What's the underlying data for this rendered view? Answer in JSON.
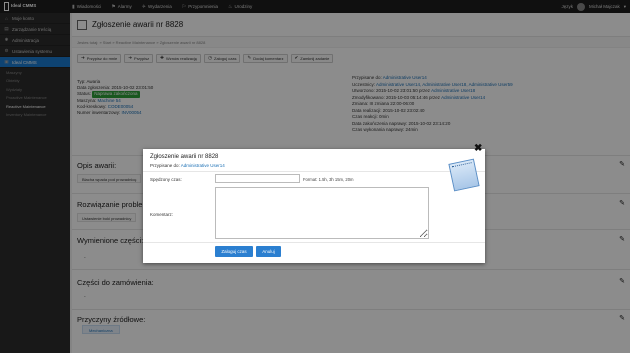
{
  "topbar": {
    "logo": "Ideal CMMS",
    "nav": [
      {
        "icon": "bell-icon",
        "label": "Wiadomości"
      },
      {
        "icon": "alarm-icon",
        "label": "Alarmy"
      },
      {
        "icon": "plane-icon",
        "label": "Wydarzenia"
      },
      {
        "icon": "flag-icon",
        "label": "Przypomnienia"
      },
      {
        "icon": "fire-icon",
        "label": "Urodziny"
      }
    ],
    "language": "Język",
    "user": "Michał Majczak"
  },
  "sidebar": {
    "items": [
      {
        "icon": "home-icon",
        "label": "Moje konto"
      },
      {
        "icon": "chart-icon",
        "label": "Zarządzanie treścią"
      },
      {
        "icon": "gear-icon",
        "label": "Administracja"
      },
      {
        "icon": "tools-icon",
        "label": "Ustawienia systemu"
      },
      {
        "icon": "cmms-icon",
        "label": "Ideal CMMS"
      }
    ],
    "subitems": [
      "Maszyny",
      "Obiekty",
      "Wydziały",
      "Proactive Maintenance",
      "Reactive Maintenance",
      "Inventory Maintenance"
    ]
  },
  "page": {
    "title": "Zgłoszenie awarii nr 8828",
    "breadcrumb": "Jestes tutaj: » Start » Reactive Maintenance » Zgłoszenie awarii nr 8828",
    "toolbar": [
      {
        "icon": "arrow-right-icon",
        "label": "Przypisz do mnie"
      },
      {
        "icon": "arrow-right-icon",
        "label": "Przypisz"
      },
      {
        "icon": "plus-icon",
        "label": "Wznów realizację"
      },
      {
        "icon": "clock-icon",
        "label": "Zaloguj czas"
      },
      {
        "icon": "comment-icon",
        "label": "Dodaj komentarz"
      },
      {
        "icon": "check-icon",
        "label": "Zamknij zadanie"
      }
    ]
  },
  "info_left": {
    "type": "Typ: Awaria",
    "date": "Data zgłoszenia: 2015-10-02 23:01:50",
    "status_label": "Status:",
    "status_badge": "Naprawa zakończona",
    "machine_label": "Maszyna:",
    "machine": "Machine 54",
    "code_label": "Kod-kreskowy:",
    "code": "CODE00054",
    "inv_label": "Numer inwentarzowy:",
    "inv": "INV00054"
  },
  "info_right": {
    "assigned_label": "Przypisane do:",
    "assigned": "Administrative User14",
    "participants_label": "Uczestnicy:",
    "participants": "Administrative User14, Administrative User18, Administrative User59",
    "created_label": "Utworzono: 2015-10-02 23:01:50 przez",
    "created_by": "Administrative User18",
    "modified_label": "Zmodyfikowano: 2015-10-03 05:14:46 przez",
    "modified_by": "Administrative User14",
    "shift": "Zmiana: III zmiana 22:00-06:00",
    "realization_date": "Data realizacji: 2015-10-02 23:02:40",
    "reaction_time": "Czas reakcji: 0min",
    "completion_date": "Data zakończenia naprawy: 2015-10-02 23:14:20",
    "repair_time": "Czas wykonania naprawy: 24min"
  },
  "sections": [
    {
      "title": "Opis awarii:",
      "content": "Blacha wpada pod prowadnicę"
    },
    {
      "title": "Rozwiązanie problemu:",
      "content": "Ustawienie boki prowadnicy"
    },
    {
      "title": "Wymienione części:",
      "content": "-"
    },
    {
      "title": "Części do zamówienia:",
      "content": "-"
    },
    {
      "title": "Przyczyny źródłowe:",
      "content": "Mechaniczna"
    }
  ],
  "modal": {
    "title": "Zgłoszenie awarii nr 8828",
    "assigned_label": "Przypisane do:",
    "assigned": "Administrative User14",
    "time_label": "Spędzony czas:",
    "time_value": "",
    "time_hint": "Format: 1.5h, 3h 15m, 20m",
    "comment_label": "Komentarz:",
    "comment_value": "",
    "save_label": "Zaloguj czas",
    "cancel_label": "Anuluj"
  },
  "colors": {
    "accent": "#2b7fd0",
    "status_green": "#2e9e3a",
    "topbar": "#1e1e1e",
    "sidebar": "#2c2c2c"
  }
}
